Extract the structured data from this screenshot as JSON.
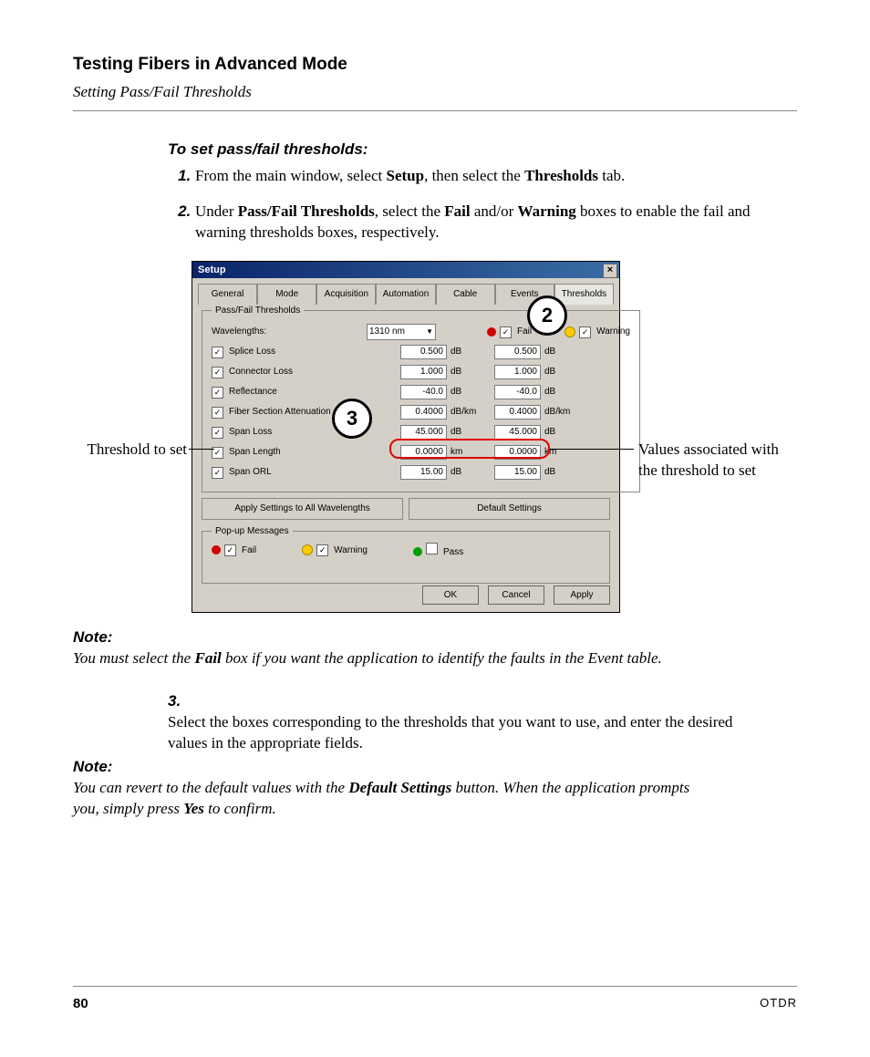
{
  "header": {
    "main": "Testing Fibers in Advanced Mode",
    "sub": "Setting Pass/Fail Thresholds"
  },
  "proc_title": "To set pass/fail thresholds:",
  "step1": {
    "pre": "From the main window, select ",
    "b1": "Setup",
    "mid": ", then select the ",
    "b2": "Thresholds",
    "post": " tab."
  },
  "step2": {
    "pre": "Under ",
    "b1": "Pass/Fail Thresholds",
    "mid1": ", select the ",
    "b2": "Fail",
    "mid2": " and/or ",
    "b3": "Warning",
    "post": " boxes to enable the fail and warning thresholds boxes, respectively."
  },
  "dialog": {
    "title": "Setup",
    "close": "×",
    "tabs": [
      "General",
      "Mode",
      "Acquisition",
      "Automation",
      "Cable",
      "Events",
      "Thresholds"
    ],
    "group": "Pass/Fail Thresholds",
    "wl_label": "Wavelengths:",
    "wl_value": "1310 nm",
    "fail": "Fail",
    "warn": "Warning",
    "rows": [
      {
        "label": "Splice Loss",
        "f": "0.500",
        "w": "0.500",
        "u": "dB"
      },
      {
        "label": "Connector Loss",
        "f": "1.000",
        "w": "1.000",
        "u": "dB"
      },
      {
        "label": "Reflectance",
        "f": "-40.0",
        "w": "-40.0",
        "u": "dB"
      },
      {
        "label": "Fiber Section Attenuation",
        "f": "0.4000",
        "w": "0.4000",
        "u": "dB/km"
      },
      {
        "label": "Span Loss",
        "f": "45.000",
        "w": "45.000",
        "u": "dB"
      },
      {
        "label": "Span Length",
        "f": "0.0000",
        "w": "0.0000",
        "u": "km"
      },
      {
        "label": "Span ORL",
        "f": "15.00",
        "w": "15.00",
        "u": "dB"
      }
    ],
    "btn_apply_all": "Apply Settings to All Wavelengths",
    "btn_default": "Default Settings",
    "popup_group": "Pop-up Messages",
    "pass": "Pass",
    "ok": "OK",
    "cancel": "Cancel",
    "apply": "Apply",
    "check": "✓"
  },
  "ann": {
    "c2": "2",
    "c3": "3",
    "left": "Threshold to set",
    "right": "Values associated with the threshold to set"
  },
  "note1": {
    "label": "Note:",
    "pre": "You must select the ",
    "b": "Fail",
    "post": " box if you want the application to identify the faults in the Event table."
  },
  "step3": {
    "num": "3.",
    "text": "Select the boxes corresponding to the thresholds that you want to use, and enter the desired values in the appropriate fields."
  },
  "note2": {
    "label": "Note:",
    "pre": "You can revert to the default values with the ",
    "b1": "Default Settings",
    "mid": " button. When the application prompts you, simply press ",
    "b2": "Yes",
    "post": " to confirm."
  },
  "footer": {
    "page": "80",
    "doc": "OTDR"
  }
}
